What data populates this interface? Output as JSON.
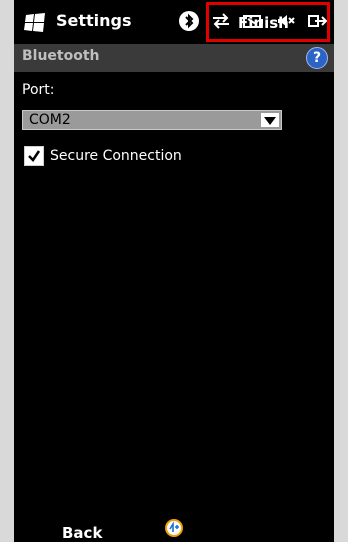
{
  "header": {
    "title": "Settings"
  },
  "subheader": {
    "label": "Bluetooth",
    "help_symbol": "?"
  },
  "form": {
    "port_label": "Port:",
    "port_value": "COM2",
    "secure_connection_label": "Secure Connection",
    "secure_connection_checked": true
  },
  "softkeys": {
    "left": "Back",
    "right": "Finish"
  },
  "colors": {
    "highlight": "#e00000",
    "help_blue": "#2b63c7"
  },
  "icons": {
    "start": "windows-flag-icon",
    "status": [
      "bluetooth-icon",
      "sync-icon",
      "battery-icon",
      "volume-icon",
      "connection-icon"
    ],
    "center": "keyboard-icon"
  }
}
